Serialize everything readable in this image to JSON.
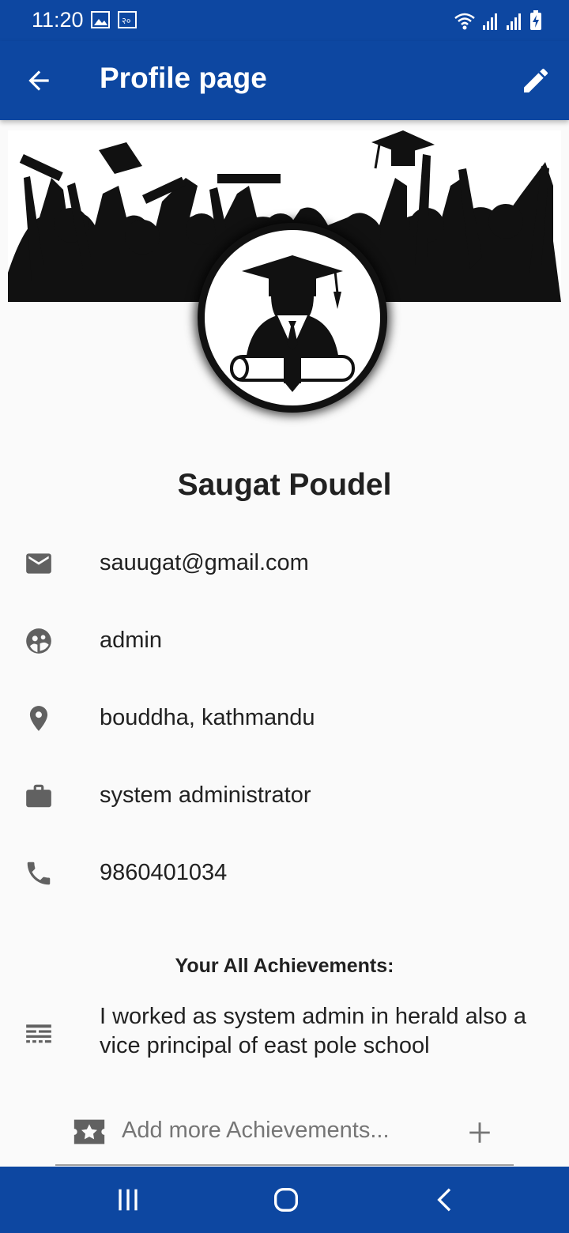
{
  "status_bar": {
    "time": "11:20"
  },
  "app_bar": {
    "title": "Profile page"
  },
  "profile": {
    "name": "Saugat Poudel",
    "email": "sauugat@gmail.com",
    "role": "admin",
    "address": "bouddha, kathmandu",
    "occupation": "system administrator",
    "phone": "9860401034"
  },
  "achievements": {
    "title": "Your All Achievements:",
    "items": [
      "I worked as system admin in herald also a vice principal of east pole school"
    ],
    "add_placeholder": "Add more Achievements..."
  },
  "icons": {
    "back": "arrow-back-icon",
    "edit": "edit-icon",
    "email": "email-icon",
    "role": "face-icon",
    "address": "location-pin-icon",
    "occupation": "briefcase-icon",
    "phone": "phone-icon",
    "achievement": "notes-icon",
    "add_achievement": "star-badge-icon",
    "add": "plus-icon"
  },
  "colors": {
    "primary": "#0d47a1",
    "icon_grey": "#616161",
    "background": "#fafafa"
  }
}
